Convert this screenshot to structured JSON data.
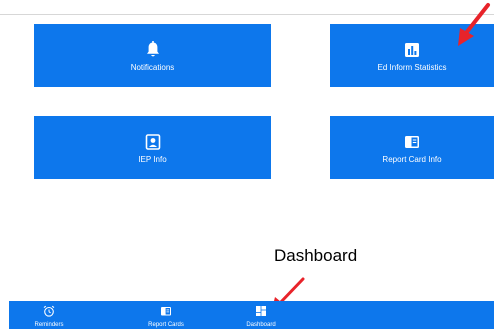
{
  "tiles": {
    "notifications": {
      "label": "Notifications",
      "icon": "bell-icon"
    },
    "ed_inform": {
      "label": "Ed Inform Statistics",
      "icon": "bar-chart-icon"
    },
    "iep": {
      "label": "IEP Info",
      "icon": "user-card-icon"
    },
    "report_card": {
      "label": "Report Card Info",
      "icon": "report-card-icon"
    }
  },
  "annotation": {
    "callout_text": "Dashboard",
    "arrow_color": "#e8232a"
  },
  "tab_bar": {
    "tabs": [
      {
        "label": "Reminders",
        "icon": "alarm-clock-icon"
      },
      {
        "label": "Report Cards",
        "icon": "report-card-icon"
      },
      {
        "label": "Dashboard",
        "icon": "dashboard-icon",
        "active": true
      }
    ]
  },
  "colors": {
    "primary": "#0d77ec",
    "text_on_primary": "#ffffff"
  }
}
